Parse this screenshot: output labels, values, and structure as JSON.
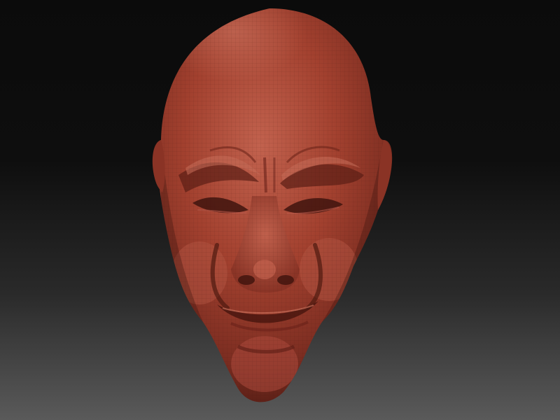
{
  "scene": {
    "subject": "sculpted-head",
    "colors": {
      "background_top": "#0b0b0b",
      "background_bottom": "#5a5a5a",
      "clay_base": "#a2402f",
      "clay_highlight": "#c0604d",
      "clay_shadow": "#5a1f16"
    }
  }
}
